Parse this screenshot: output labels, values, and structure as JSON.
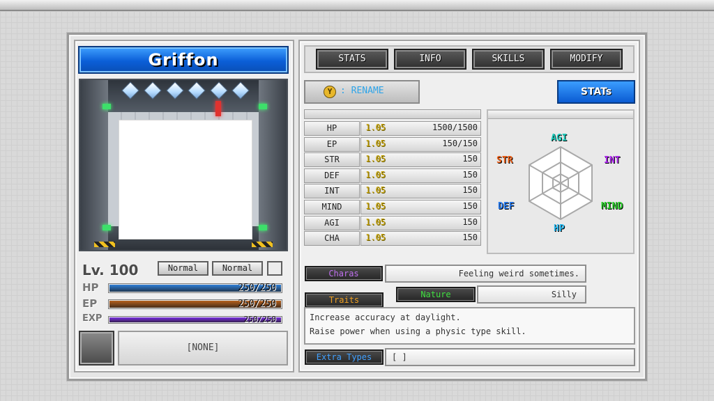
{
  "character": {
    "name": "Griffon",
    "level": "Lv. 100",
    "types": [
      "Normal",
      "Normal"
    ],
    "bars": [
      {
        "label": "HP",
        "text": "250/250",
        "fraction": 1.0,
        "color": "#2f7fd8"
      },
      {
        "label": "EP",
        "text": "250/250",
        "fraction": 1.0,
        "color": "#b4601c"
      },
      {
        "label": "EXP",
        "text": "250/250",
        "fraction": 1.0,
        "color": "#7a2fe0"
      }
    ],
    "slot": "[NONE]"
  },
  "tabs": [
    "STATS",
    "INFO",
    "SKILLS",
    "MODIFY"
  ],
  "rename": {
    "button": "Y",
    "label": ": RENAME"
  },
  "stats_button": "STATs",
  "stats": [
    {
      "name": "HP",
      "mult": "1.05",
      "value": "1500/1500"
    },
    {
      "name": "EP",
      "mult": "1.05",
      "value": "150/150"
    },
    {
      "name": "STR",
      "mult": "1.05",
      "value": "150"
    },
    {
      "name": "DEF",
      "mult": "1.05",
      "value": "150"
    },
    {
      "name": "INT",
      "mult": "1.05",
      "value": "150"
    },
    {
      "name": "MIND",
      "mult": "1.05",
      "value": "150"
    },
    {
      "name": "AGI",
      "mult": "1.05",
      "value": "150"
    },
    {
      "name": "CHA",
      "mult": "1.05",
      "value": "150"
    }
  ],
  "radar": {
    "labels": {
      "agi": {
        "text": "AGI",
        "color": "#1fd0c0"
      },
      "int": {
        "text": "INT",
        "color": "#b02cf0"
      },
      "mind": {
        "text": "MIND",
        "color": "#2ad02a"
      },
      "hp": {
        "text": "HP",
        "color": "#28b8f0"
      },
      "def": {
        "text": "DEF",
        "color": "#2a7df0"
      },
      "str": {
        "text": "STR",
        "color": "#f06018"
      }
    }
  },
  "charas": {
    "label": "Charas",
    "value": "Feeling weird sometimes.",
    "label_color": "#c070f0"
  },
  "nature": {
    "label": "Nature",
    "value": "Silly",
    "label_color": "#40e040"
  },
  "traits": {
    "label": "Traits",
    "label_color": "#f0a020",
    "lines": [
      "Increase accuracy at daylight.",
      "Raise power when using a physic type skill."
    ]
  },
  "extra_types": {
    "label": "Extra Types",
    "value": "[ ]",
    "label_color": "#40a0ff"
  }
}
